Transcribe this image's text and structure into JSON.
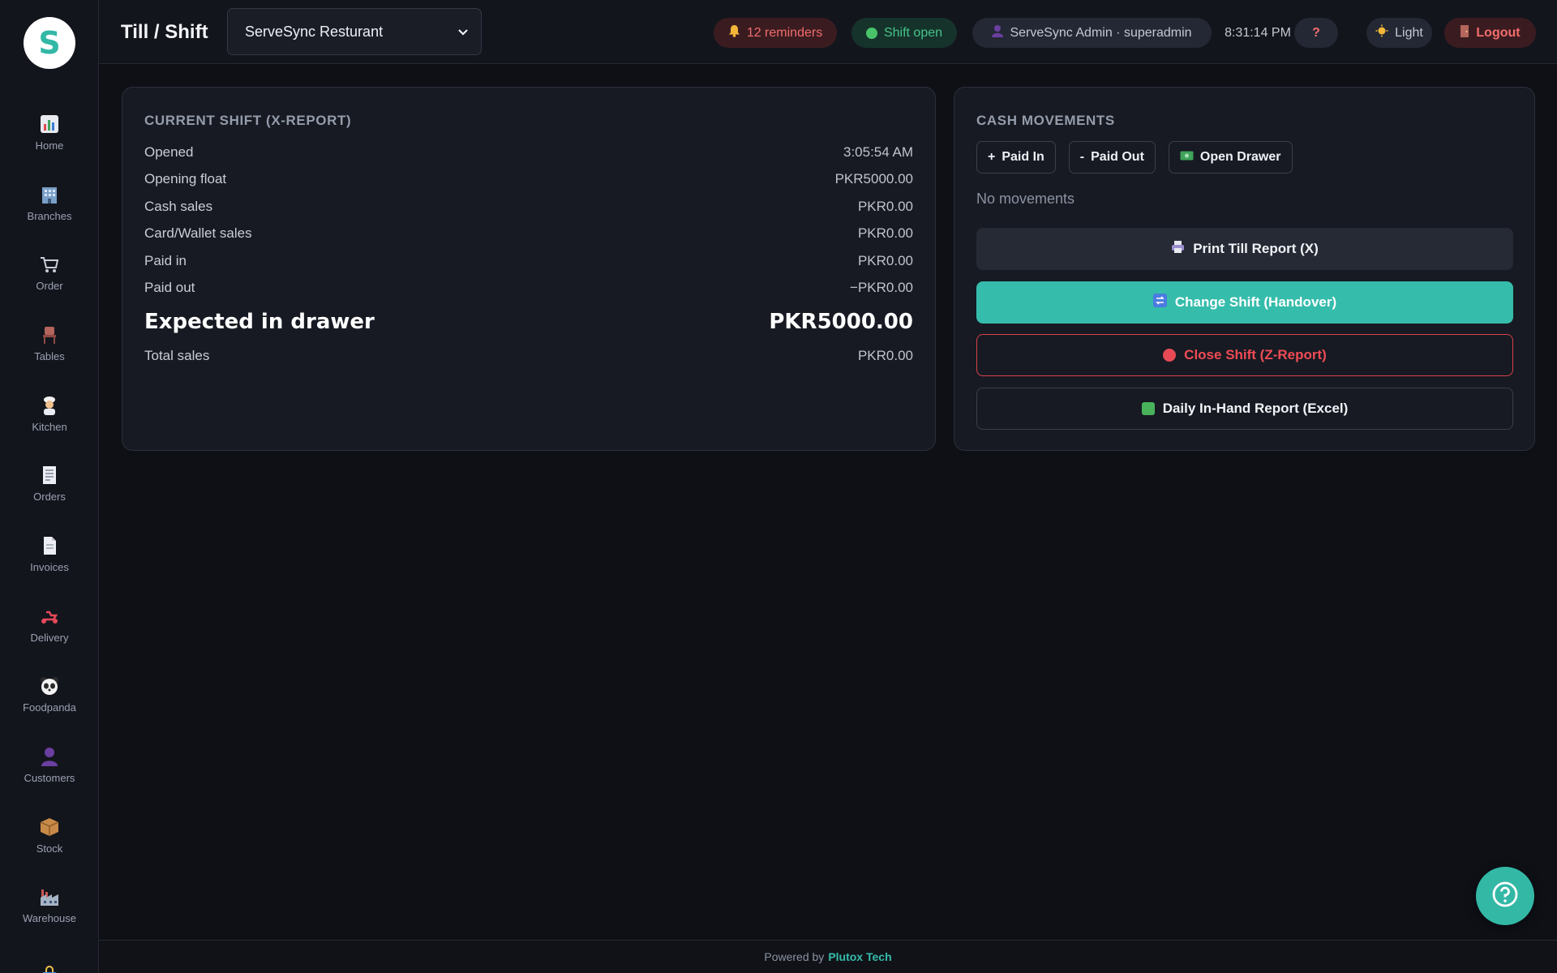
{
  "sidebar": {
    "logo_letter": "S",
    "items": [
      {
        "label": "Home",
        "icon": "chart-icon"
      },
      {
        "label": "Branches",
        "icon": "building-icon"
      },
      {
        "label": "Order",
        "icon": "cart-icon"
      },
      {
        "label": "Tables",
        "icon": "chair-icon"
      },
      {
        "label": "Kitchen",
        "icon": "chef-icon"
      },
      {
        "label": "Orders",
        "icon": "receipt-icon"
      },
      {
        "label": "Invoices",
        "icon": "document-icon"
      },
      {
        "label": "Delivery",
        "icon": "scooter-icon"
      },
      {
        "label": "Foodpanda",
        "icon": "panda-icon"
      },
      {
        "label": "Customers",
        "icon": "person-icon"
      },
      {
        "label": "Stock",
        "icon": "box-icon"
      },
      {
        "label": "Warehouse",
        "icon": "factory-icon"
      }
    ]
  },
  "header": {
    "title": "Till / Shift",
    "branch": "ServeSync Resturant",
    "reminders": "12 reminders",
    "shift_status": "Shift open",
    "user": "ServeSync Admin · superadmin",
    "time": "8:31:14 PM",
    "help": "?",
    "theme": "Light",
    "logout": "Logout"
  },
  "shift": {
    "title": "Current Shift (X-Report)",
    "rows": [
      {
        "label": "Opened",
        "value": "3:05:54 AM"
      },
      {
        "label": "Opening float",
        "value": "PKR5000.00"
      },
      {
        "label": "Cash sales",
        "value": "PKR0.00"
      },
      {
        "label": "Card/Wallet sales",
        "value": "PKR0.00"
      },
      {
        "label": "Paid in",
        "value": "PKR0.00"
      },
      {
        "label": "Paid out",
        "value": "−PKR0.00"
      }
    ],
    "expected_label": "Expected in drawer",
    "expected_value": "PKR5000.00",
    "total_label": "Total sales",
    "total_value": "PKR0.00"
  },
  "cash": {
    "title": "Cash Movements",
    "paid_in": "Paid In",
    "paid_out": "Paid Out",
    "open_drawer": "Open Drawer",
    "empty": "No movements",
    "print_report": "Print Till Report (X)",
    "change_shift": "Change Shift (Handover)",
    "close_shift": "Close Shift (Z-Report)",
    "daily_report": "Daily In-Hand Report (Excel)"
  },
  "footer": {
    "prefix": "Powered by",
    "brand": "Plutox Tech"
  },
  "colors": {
    "accent": "#36bcab",
    "danger": "#f04b55",
    "success": "#45c48a",
    "background": "#0e1016"
  }
}
